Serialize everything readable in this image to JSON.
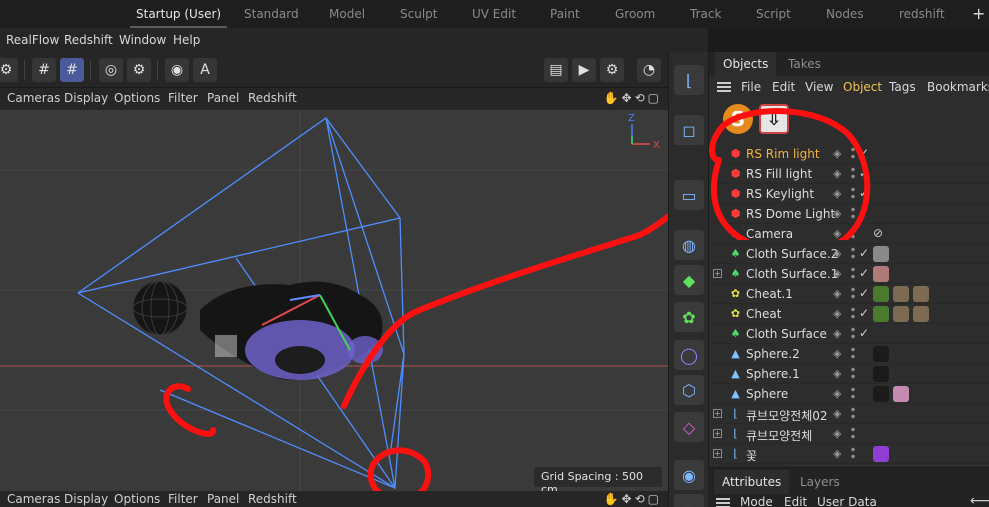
{
  "layout_tabs": [
    "Startup (User)",
    "Standard",
    "Model",
    "Sculpt",
    "UV Edit",
    "Paint",
    "Groom",
    "Track",
    "Script",
    "Nodes",
    "redshift"
  ],
  "active_layout": "Startup (User)",
  "main_menu": [
    "RealFlow",
    "Redshift",
    "Window",
    "Help"
  ],
  "viewport_menu": [
    "Cameras",
    "Display",
    "Options",
    "Filter",
    "Panel",
    "Redshift"
  ],
  "viewport": {
    "grid_spacing": "Grid Spacing : 500 cm",
    "axis_z": "Z",
    "axis_x": "X"
  },
  "om": {
    "tabs": [
      "Objects",
      "Takes"
    ],
    "active_tab": "Objects",
    "menu": [
      "File",
      "Edit",
      "View",
      "Object",
      "Tags",
      "Bookmarks"
    ],
    "highlight_menu": "Object",
    "objects": [
      {
        "name": "RS Rim light",
        "type": "rs-light",
        "selected": true,
        "expand": false
      },
      {
        "name": "RS Fill light",
        "type": "rs-light",
        "selected": false,
        "expand": false
      },
      {
        "name": "RS Keylight",
        "type": "rs-light",
        "selected": false,
        "expand": false
      },
      {
        "name": "RS Dome Light",
        "type": "rs-light",
        "selected": false,
        "expand": false
      },
      {
        "name": "Camera",
        "type": "camera",
        "selected": false,
        "expand": false
      },
      {
        "name": "Cloth Surface.2",
        "type": "cloth",
        "selected": false,
        "expand": false
      },
      {
        "name": "Cloth Surface.1",
        "type": "cloth",
        "selected": false,
        "expand": true
      },
      {
        "name": "Cheat.1",
        "type": "cheat",
        "selected": false,
        "expand": false
      },
      {
        "name": "Cheat",
        "type": "cheat",
        "selected": false,
        "expand": false
      },
      {
        "name": "Cloth Surface",
        "type": "cloth",
        "selected": false,
        "expand": false
      },
      {
        "name": "Sphere.2",
        "type": "sphere",
        "selected": false,
        "expand": false
      },
      {
        "name": "Sphere.1",
        "type": "sphere",
        "selected": false,
        "expand": false
      },
      {
        "name": "Sphere",
        "type": "sphere",
        "selected": false,
        "expand": false
      },
      {
        "name": "큐브모양전체02",
        "type": "null",
        "selected": false,
        "expand": true
      },
      {
        "name": "큐브모양전체",
        "type": "null",
        "selected": false,
        "expand": true
      },
      {
        "name": "꽃",
        "type": "null",
        "selected": false,
        "expand": true
      }
    ]
  },
  "attr": {
    "tabs": [
      "Attributes",
      "Layers"
    ],
    "active_tab": "Attributes",
    "menu": [
      "Mode",
      "Edit",
      "User Data"
    ]
  },
  "colors": {
    "selected_text": "#f2b440",
    "highlight_menu": "#f0c454",
    "annotation": "#ff1010",
    "camera_lines": "#4f8dff"
  },
  "icons": {
    "om_s": "S",
    "om_download": "⇩"
  }
}
